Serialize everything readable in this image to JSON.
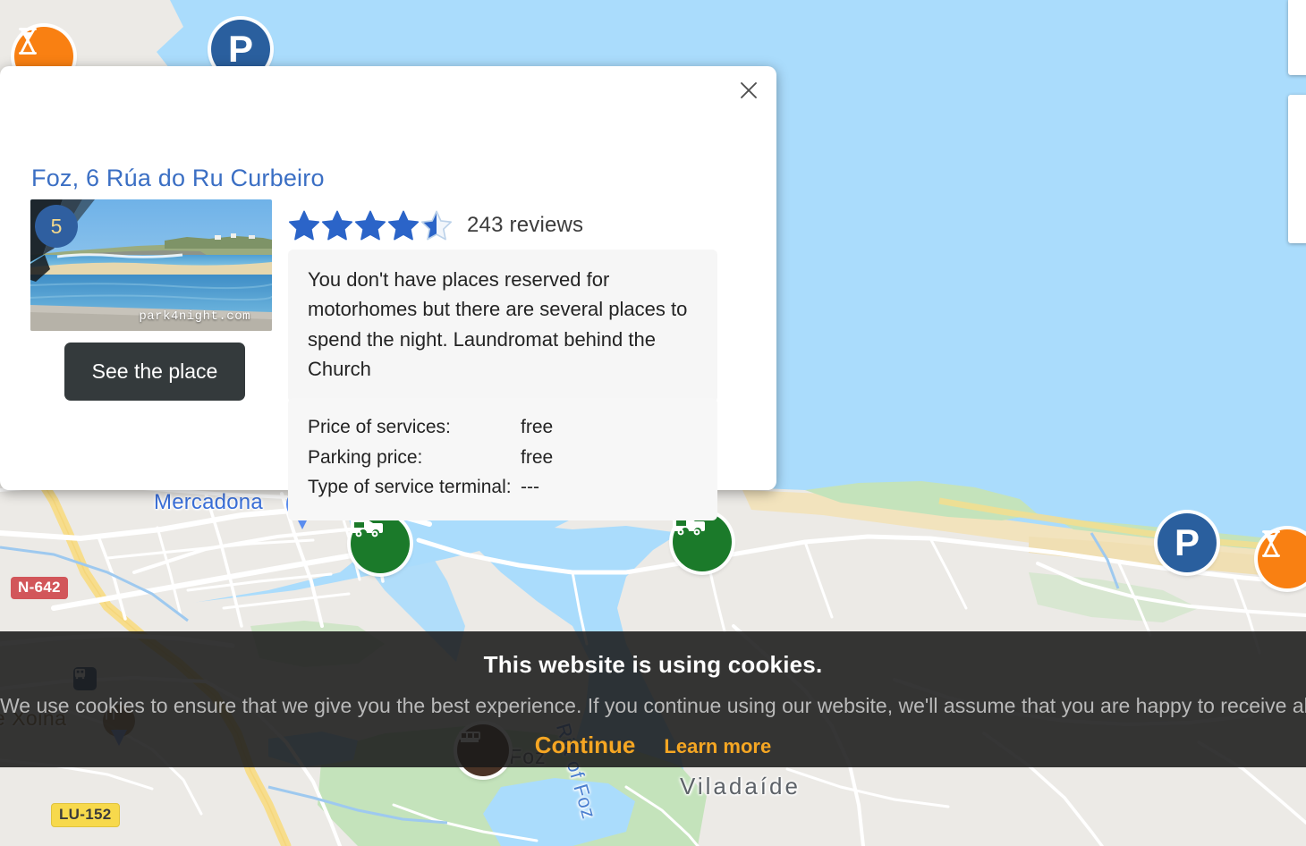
{
  "popup": {
    "title": "Foz, 6 Rúa do Ru Curbeiro",
    "close_label": "✕",
    "rank_badge": "5",
    "photo_watermark": "park4night.com",
    "see_place_label": "See the place",
    "rating_value": 4.5,
    "rating_max": 5,
    "reviews_text": "243 reviews",
    "review_body": "You don't have places reserved for motorhomes but there are several places to spend the night. Laundromat behind the Church",
    "specs": [
      {
        "label": "Price of services:",
        "value": "free"
      },
      {
        "label": "Parking price:",
        "value": "free"
      },
      {
        "label": "Type of service terminal:",
        "value": "---"
      }
    ]
  },
  "cookie_banner": {
    "title": "This website is using cookies.",
    "message": "We use cookies to ensure that we give you the best experience. If you continue using our website, we'll assume that you are happy to receive all cookies on this website.",
    "continue_label": "Continue",
    "learn_more_label": "Learn more"
  },
  "map": {
    "labels": {
      "mercadona": "Mercadona",
      "viladaide": "Viladaíde",
      "xoina": "te Xoiña",
      "ria_of_foz": "Ria of Foz",
      "foz_town": "e Foz"
    },
    "road_shields": [
      {
        "id": "n642",
        "text": "N-642",
        "color": "#d2565a"
      },
      {
        "id": "lu152",
        "text": "LU-152",
        "color": "#f7d94c"
      }
    ],
    "markers": [
      {
        "id": "service-point-top-left",
        "icon": "hourglass-icon",
        "color": "#f98012"
      },
      {
        "id": "parking-top",
        "icon": "parking-icon",
        "color": "#2a5f9e"
      },
      {
        "id": "motorhome-area-left",
        "icon": "motorhome-icon",
        "color": "#1b7a2a"
      },
      {
        "id": "motorhome-area-center",
        "icon": "motorhome-icon",
        "color": "#1b7a2a"
      },
      {
        "id": "parking-right",
        "icon": "parking-icon",
        "color": "#2a5f9e"
      },
      {
        "id": "service-point-right",
        "icon": "hourglass-icon",
        "color": "#f98012"
      },
      {
        "id": "mercadona-store",
        "icon": "shopping-cart-icon",
        "color": "#5b8def"
      },
      {
        "id": "picnic-area",
        "icon": "picnic-icon",
        "color": "#8a6a3c"
      },
      {
        "id": "campsite-bottom",
        "icon": "campsite-icon",
        "color": "#4a3326"
      },
      {
        "id": "transit-stop",
        "icon": "bus-icon",
        "color": "#2a4a74"
      }
    ]
  },
  "colors": {
    "water": "#aadcfc",
    "land": "#eceae6",
    "park_green": "#c4e3bb",
    "sand": "#f2e3bd",
    "road_white": "#ffffff",
    "road_yellow": "#f7dd8c",
    "accent_blue": "#3b6fc4",
    "star_blue": "#2b64c8",
    "banner_orange": "#f5a623",
    "marker_green": "#1b7a2a",
    "marker_blue": "#2a5f9e",
    "marker_orange": "#f98012",
    "button_dark": "#343a3c"
  }
}
